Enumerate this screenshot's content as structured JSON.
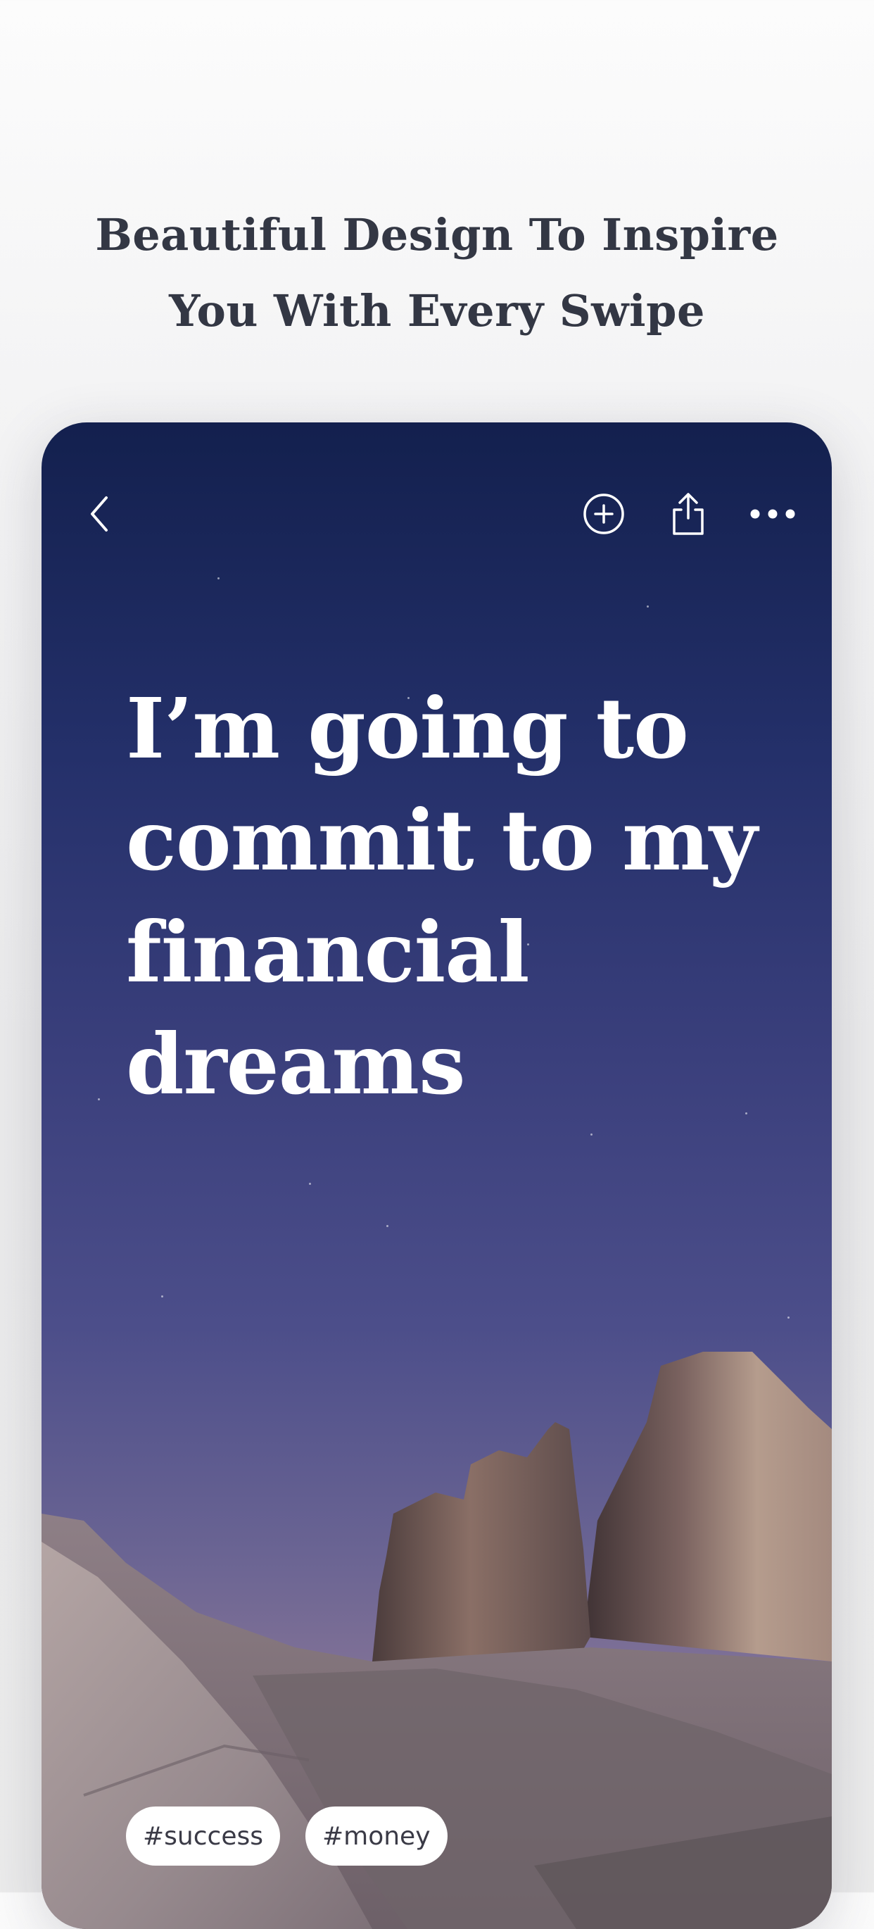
{
  "headline": {
    "line1": "Beautiful Design To Inspire",
    "line2": "You With Every Swipe"
  },
  "card": {
    "top_bar": {
      "back_icon": "chevron-left-icon",
      "add_icon": "plus-circle-icon",
      "share_icon": "share-icon",
      "more_icon": "more-horizontal-icon"
    },
    "quote": {
      "line1": "I’m going to",
      "line2": "commit to my",
      "line3": "financial",
      "line4": "dreams"
    },
    "tags": [
      "#success",
      "#money"
    ]
  }
}
